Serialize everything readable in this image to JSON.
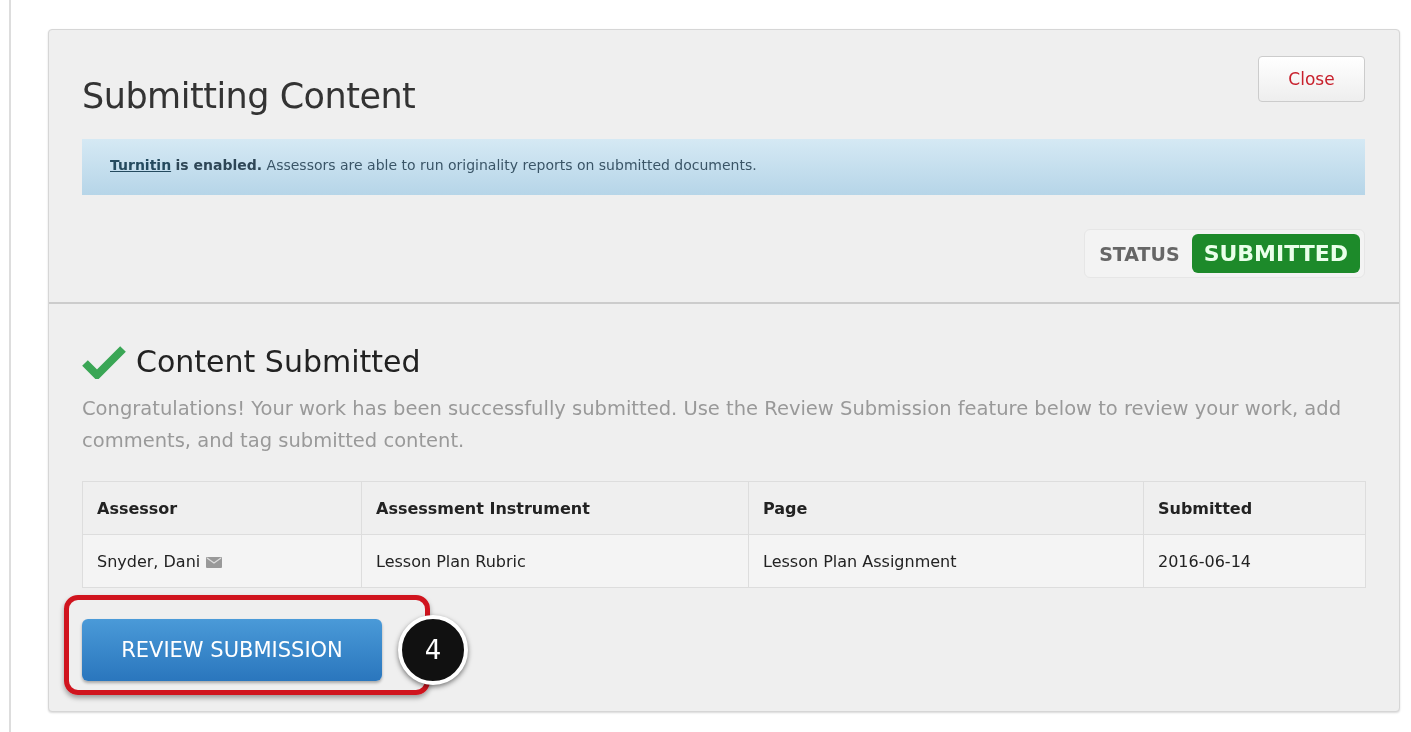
{
  "dialog": {
    "title": "Submitting Content",
    "close_button": "Close"
  },
  "notice": {
    "link": "Turnitin",
    "text": "**is enabled.** Assessors are able to run originality reports on submitted documents."
  },
  "status": {
    "label": "STATUS",
    "value": "SUBMITTED"
  },
  "result": {
    "heading": "Content Submitted",
    "message": "Congratulations! Your work has been successfully submitted. Use the Review Submission feature below to review your work, add comments, and tag submitted content."
  },
  "table": {
    "columns": [
      "Assessor",
      "Assessment Instrument",
      "Page",
      "Submitted"
    ],
    "rows": [
      [
        "Snyder, Dani",
        "Lesson Plan Rubric",
        "Lesson Plan Assignment",
        "2016-06-14"
      ]
    ]
  },
  "review_button": "REVIEW SUBMISSION",
  "step_badge": "4"
}
